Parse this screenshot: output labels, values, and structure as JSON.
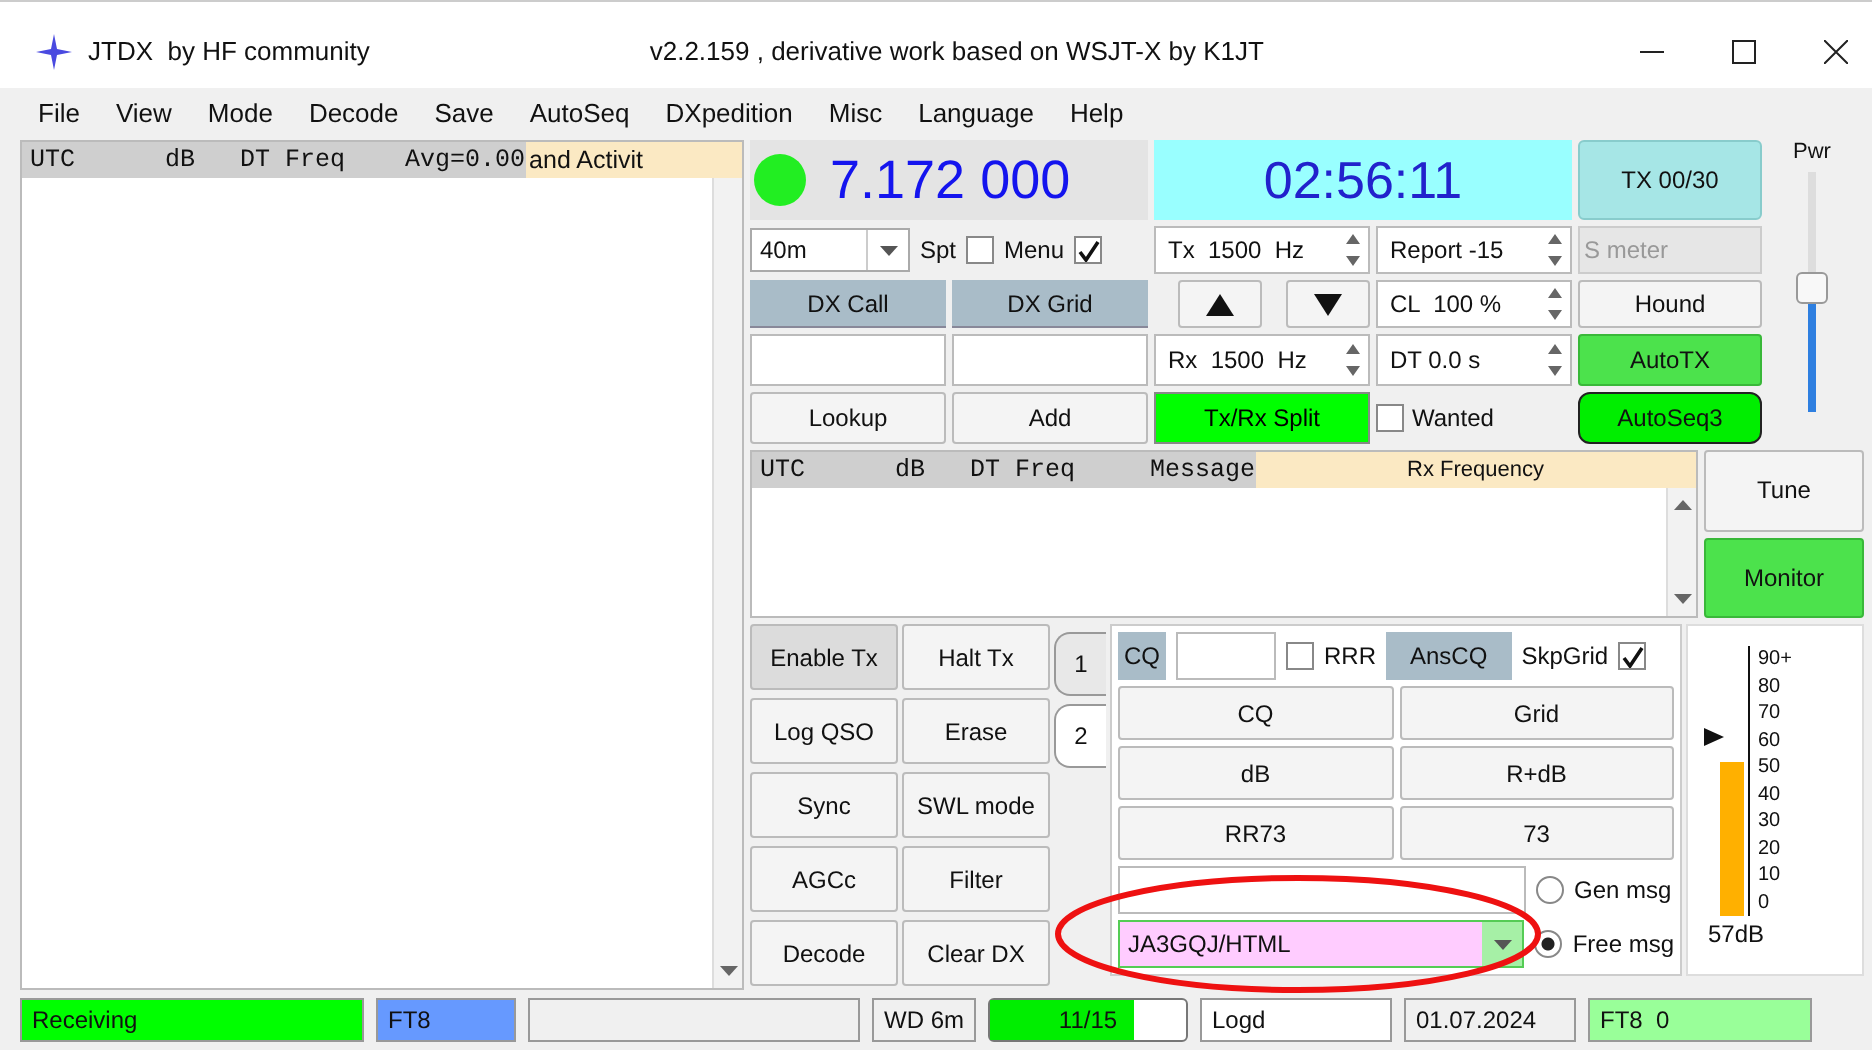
{
  "window": {
    "title": "JTDX  by HF community",
    "subtitle": "v2.2.159 , derivative work based on WSJT-X by K1JT"
  },
  "menu": [
    "File",
    "View",
    "Mode",
    "Decode",
    "Save",
    "AutoSeq",
    "DXpedition",
    "Misc",
    "Language",
    "Help"
  ],
  "band_activity": {
    "header": "UTC      dB   DT Freq    Avg=0.00",
    "label": "and Activit"
  },
  "dial": {
    "on": true,
    "frequency": "7.172 000"
  },
  "clock": "02:56:11",
  "tx_counter": "TX 00/30",
  "band": "40m",
  "options": [
    {
      "label": "Spt",
      "checked": false
    },
    {
      "label": "Menu",
      "checked": true
    }
  ],
  "dx": {
    "call_label": "DX Call",
    "grid_label": "DX Grid",
    "lookup": "Lookup",
    "add": "Add"
  },
  "spins": [
    {
      "value": "Tx  1500  Hz"
    },
    {
      "value": "Report -15"
    },
    {
      "value": "CL  100 %"
    },
    {
      "value": "Rx  1500  Hz"
    },
    {
      "value": "DT 0.0 s"
    }
  ],
  "smeter": {
    "label": "S meter",
    "disabled": true
  },
  "split": {
    "label": "Tx/Rx Split",
    "on": true
  },
  "wanted": {
    "label": "Wanted",
    "checked": false
  },
  "toggles": [
    {
      "label": "Hound",
      "on": false
    },
    {
      "label": "AutoTX",
      "on": true
    },
    {
      "label": "AutoSeq3",
      "on": true
    }
  ],
  "power": {
    "label": "Pwr",
    "level": 0.52
  },
  "rx_panel": {
    "header": "UTC      dB   DT Freq     Message",
    "label": "Rx Frequency"
  },
  "side_buttons": [
    {
      "label": "Tune",
      "on": false
    },
    {
      "label": "Monitor",
      "on": true
    }
  ],
  "action_buttons": [
    {
      "label": "Enable Tx",
      "on": true
    },
    {
      "label": "Halt Tx",
      "on": false
    },
    {
      "label": "Log QSO",
      "on": false
    },
    {
      "label": "Erase",
      "on": false
    },
    {
      "label": "Sync",
      "on": false
    },
    {
      "label": "SWL mode",
      "on": false
    },
    {
      "label": "AGCc",
      "on": false
    },
    {
      "label": "Filter",
      "on": false
    },
    {
      "label": "Decode",
      "on": false
    },
    {
      "label": "Clear DX",
      "on": false
    }
  ],
  "tabs": [
    {
      "label": "1",
      "selected": false
    },
    {
      "label": "2",
      "selected": true
    }
  ],
  "tab_panel": {
    "cq_label": "CQ",
    "rrr": {
      "label": "RRR",
      "checked": false
    },
    "anscq": "AnsCQ",
    "skpgrid": {
      "label": "SkpGrid",
      "checked": true
    },
    "messages": [
      "CQ",
      "Grid",
      "dB",
      "R+dB",
      "RR73",
      "73"
    ],
    "gen": {
      "label": "Gen msg",
      "selected": false
    },
    "free": {
      "label": "Free msg",
      "selected": true,
      "value": "JA3GQJ/HTML"
    }
  },
  "meter": {
    "scale": [
      "90+",
      "80",
      "70",
      "60",
      "50",
      "40",
      "30",
      "20",
      "10",
      "0"
    ],
    "reading": "57dB"
  },
  "status_bar": [
    {
      "kind": "text",
      "text": "Receiving",
      "color": "#00ff00"
    },
    {
      "kind": "text",
      "text": "FT8",
      "color": "#6699ff"
    },
    {
      "kind": "blank"
    },
    {
      "kind": "text",
      "text": "WD 6m",
      "color": "#f0f0f0"
    },
    {
      "kind": "progress",
      "text": "11/15",
      "level": 0.73
    },
    {
      "kind": "text",
      "text": "Logd",
      "color": "#ffffff"
    },
    {
      "kind": "text",
      "text": "01.07.2024",
      "color": "#f0f0f0"
    },
    {
      "kind": "text",
      "text": "FT8  0",
      "color": "#99ff99"
    }
  ],
  "annotations": [
    {
      "kind": "ellipse"
    }
  ]
}
